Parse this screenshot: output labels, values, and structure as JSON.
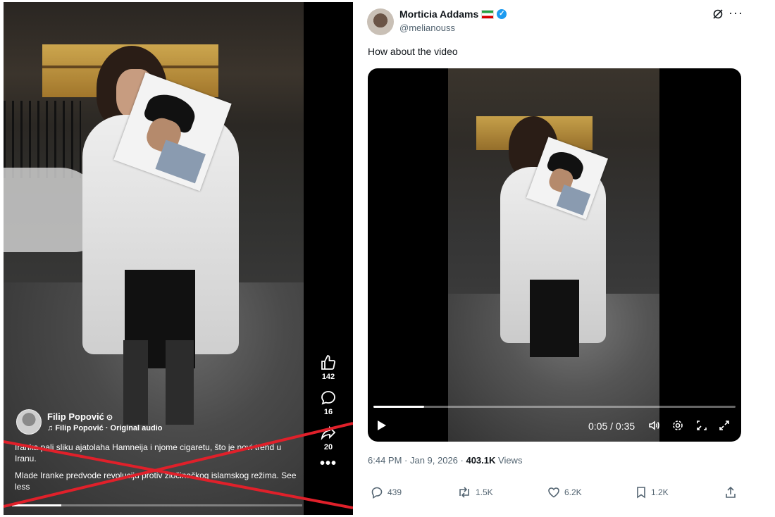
{
  "left_post": {
    "author": {
      "name": "Filip Popović",
      "verified_glyph": "⊙",
      "audio": "Filip Popović · Original audio"
    },
    "caption_line1": "Iranka pali sliku ajatolaha Hamneija i njome cigaretu, što je novi trend u Iranu.",
    "caption_line2": "Mlade Iranke predvode revoluciju protiv zločinačkog islamskog režima. See less",
    "actions": {
      "likes": "142",
      "comments": "16",
      "shares": "20",
      "more": "•••"
    },
    "progress": 0.17,
    "crossed_out": true,
    "cross_color": "#e0202a"
  },
  "tweet": {
    "author_name": "Morticia Addams",
    "handle": "@melianouss",
    "more": "···",
    "text": "How about the video",
    "video": {
      "time": "0:05 / 0:35",
      "progress": 0.14
    },
    "meta": {
      "time": "6:44 PM · Jan 9, 2026 · ",
      "views_count": "403.1K",
      "views_label": " Views"
    },
    "actions": {
      "replies": "439",
      "reposts": "1.5K",
      "likes": "6.2K",
      "bookmarks": "1.2K"
    },
    "accent_color": "#1d9bf0"
  }
}
